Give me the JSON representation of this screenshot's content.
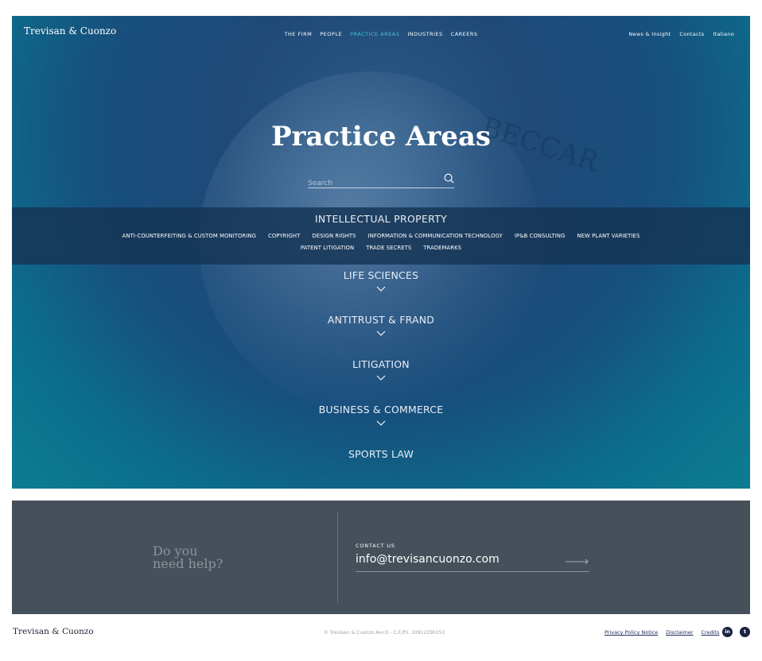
{
  "header": {
    "brand": "Trevisan & Cuonzo",
    "nav": [
      "THE FIRM",
      "PEOPLE",
      "PRACTICE AREAS",
      "INDUSTRIES",
      "CAREERS"
    ],
    "active_nav": "PRACTICE AREAS",
    "secondary_nav": [
      "News & Insight",
      "Contacts",
      "Italiano"
    ]
  },
  "hero": {
    "title": "Practice Areas",
    "search_placeholder": "Search",
    "background_letters": "BECCAR"
  },
  "practice_areas": {
    "expanded": {
      "label": "INTELLECTUAL PROPERTY",
      "items_row1": [
        "ANTI-COUNTERFEITING & CUSTOM MONITORING",
        "COPYRIGHT",
        "DESIGN RIGHTS",
        "INFORMATION & COMMUNICATION TECHNOLOGY",
        "IP&B CONSULTING",
        "NEW PLANT VARIETIES"
      ],
      "items_row2": [
        "PATENT LITIGATION",
        "TRADE SECRETS",
        "TRADEMARKS"
      ]
    },
    "collapsed": [
      "LIFE SCIENCES",
      "ANTITRUST & FRAND",
      "LITIGATION",
      "BUSINESS & COMMERCE",
      "SPORTS LAW"
    ]
  },
  "contact": {
    "help_line1": "Do you",
    "help_line2": "need help?",
    "label": "CONTACT US",
    "email": "info@trevisancuonzo.com"
  },
  "footer": {
    "brand": "Trevisan & Cuonzo",
    "copyright": "© Trevisan & Cuonzo Avv.ti - C.F./P.I. 10912290151",
    "links": [
      "Privacy Policy Notice",
      "Disclaimer",
      "Credits"
    ],
    "social": [
      "in",
      "t"
    ]
  },
  "colors": {
    "accent": "#49c3d6",
    "contact_bg": "#45505a",
    "band_bg": "#163454"
  }
}
